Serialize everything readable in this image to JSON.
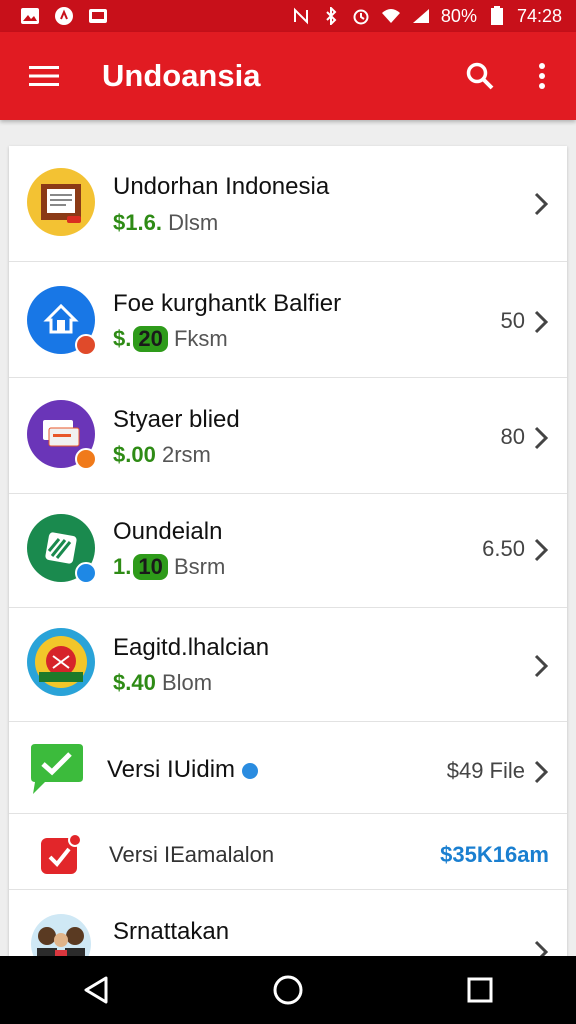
{
  "status_bar": {
    "battery": "80%",
    "time": "74:28",
    "icons": [
      "gallery-icon",
      "app-icon",
      "mail-icon",
      "mute-icon",
      "bluetooth-icon",
      "alarm-icon",
      "wifi-icon",
      "signal-icon",
      "battery-icon"
    ]
  },
  "app_bar": {
    "title": "Undoansia",
    "icons": [
      "menu-icon",
      "search-icon",
      "more-vert-icon"
    ]
  },
  "items": [
    {
      "title": "Undorhan Indonesia",
      "price": "$1.6.",
      "sub": "Dlsm",
      "meta": "",
      "icon": "document-app-icon"
    },
    {
      "title": "Foe kurghantk Balfier",
      "price": "$.",
      "pill": "20",
      "sub": "Fksm",
      "meta": "50",
      "icon": "home-app-icon"
    },
    {
      "title": "Styaer blied",
      "price": "$.00",
      "sub": "2rsm",
      "meta": "80",
      "icon": "cards-app-icon"
    },
    {
      "title": "Oundeialn",
      "price": "1.",
      "pill": "10",
      "sub": "Bsrm",
      "meta": "6.50",
      "icon": "stripes-app-icon"
    },
    {
      "title": "Eagitd.lhalcian",
      "price": "$.40",
      "sub": "Blom",
      "meta": "",
      "icon": "emblem-app-icon"
    },
    {
      "title": "Versi IUidim",
      "meta": "$49 File",
      "icon": "chat-check-icon"
    },
    {
      "title": "Versi IEamalalon",
      "meta": "$35K16am",
      "icon": "check-app-icon"
    },
    {
      "title": "Srnattakan",
      "icon": "people-avatar-icon"
    }
  ],
  "colors": {
    "status_bar": "#c8101a",
    "app_bar": "#e11b22",
    "price_green": "#2e8b15",
    "link_blue": "#1a7fd0"
  }
}
